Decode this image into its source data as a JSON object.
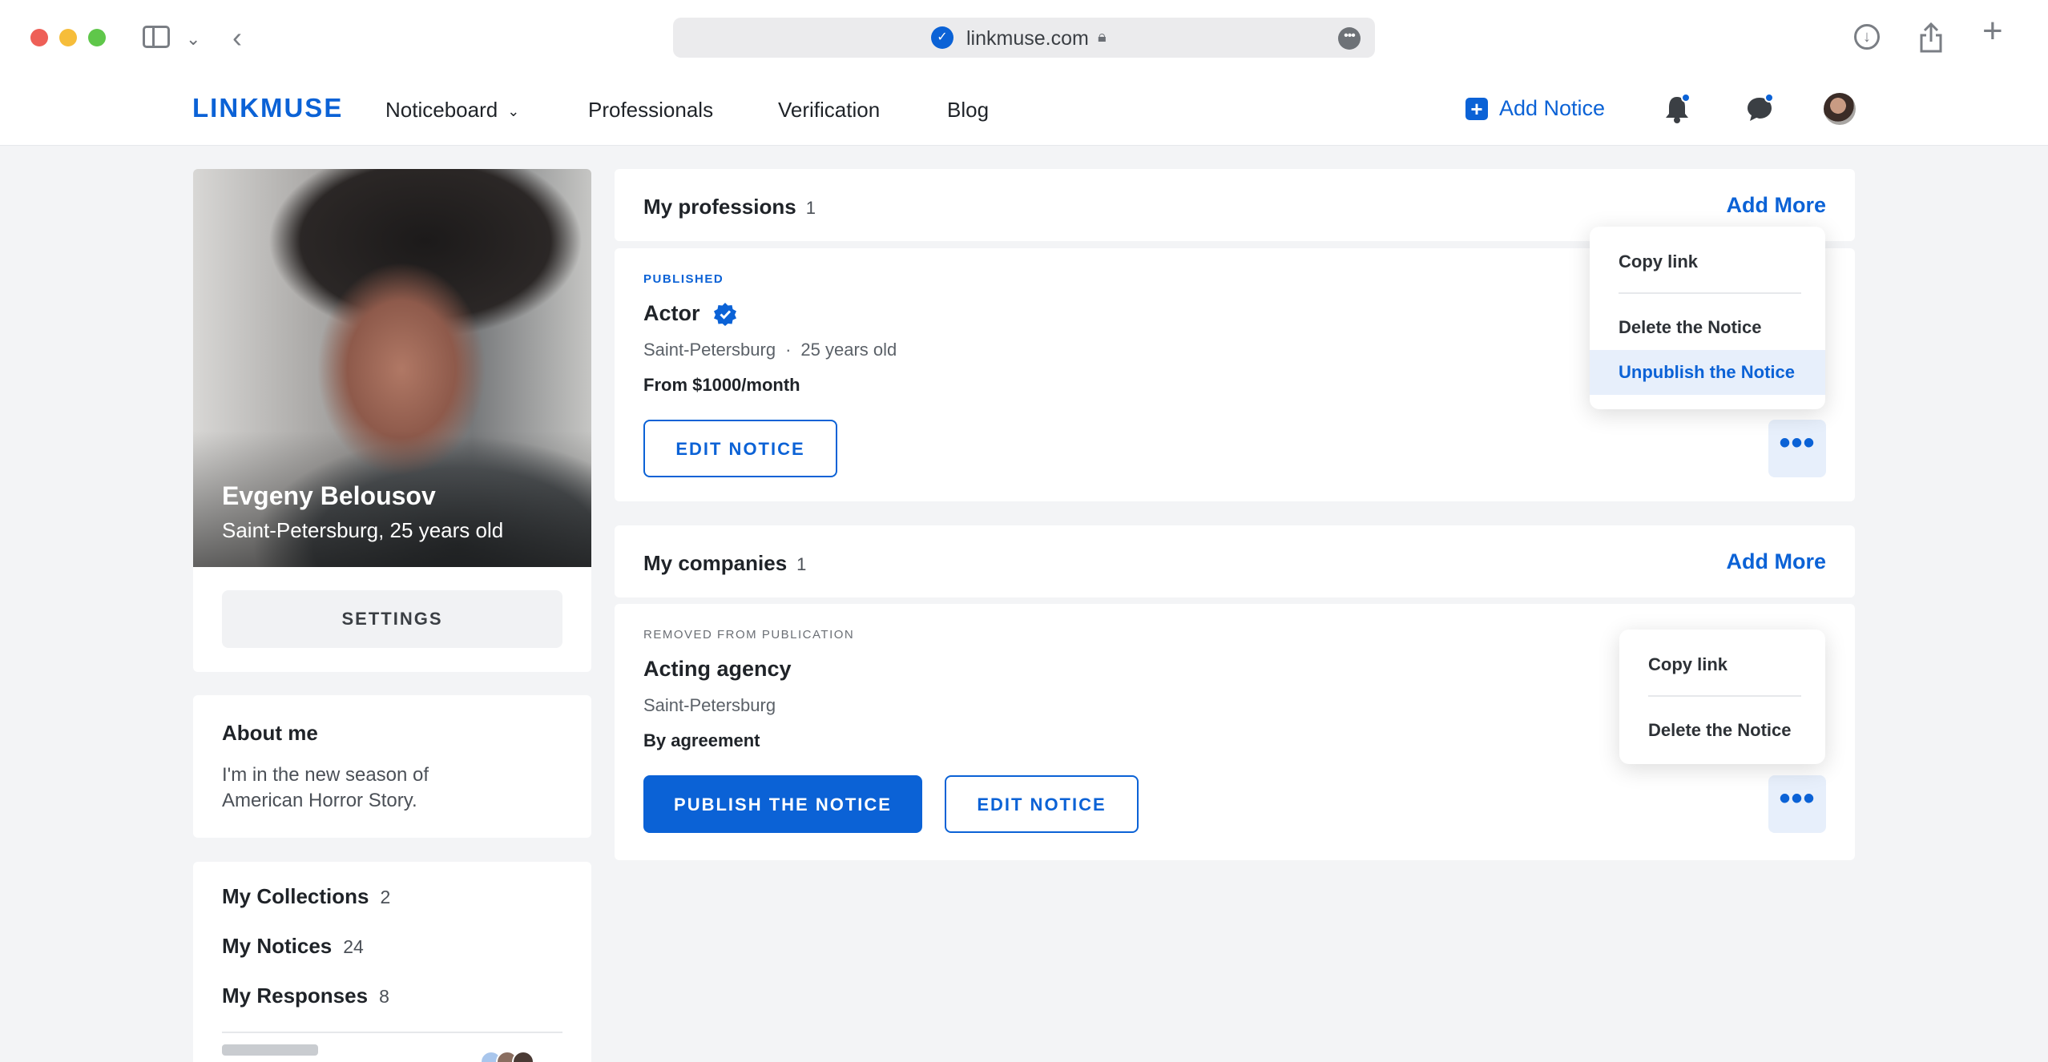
{
  "browser": {
    "url": "linkmuse.com"
  },
  "header": {
    "logo": "LINKMUSE",
    "nav": [
      "Noticeboard",
      "Professionals",
      "Verification",
      "Blog"
    ],
    "add_notice": "Add Notice"
  },
  "profile": {
    "name": "Evgeny Belousov",
    "subtitle": "Saint-Petersburg, 25 years old",
    "settings_label": "SETTINGS"
  },
  "about": {
    "title": "About me",
    "text": "I'm in the new season of American Horror Story."
  },
  "stats": [
    {
      "label": "My Collections",
      "count": "2"
    },
    {
      "label": "My Notices",
      "count": "24"
    },
    {
      "label": "My Responses",
      "count": "8"
    }
  ],
  "professions": {
    "title": "My professions",
    "count": "1",
    "add_more": "Add More",
    "item": {
      "status": "PUBLISHED",
      "title": "Actor",
      "city": "Saint-Petersburg",
      "age": "25 years old",
      "price": "From $1000/month",
      "edit_label": "EDIT NOTICE"
    },
    "menu": [
      "Copy link",
      "Delete the Notice",
      "Unpublish the Notice"
    ]
  },
  "companies": {
    "title": "My companies",
    "count": "1",
    "add_more": "Add More",
    "item": {
      "status": "REMOVED FROM PUBLICATION",
      "title": "Acting agency",
      "city": "Saint-Petersburg",
      "price": "By agreement",
      "publish_label": "PUBLISH THE NOTICE",
      "edit_label": "EDIT NOTICE"
    },
    "menu": [
      "Copy link",
      "Delete the Notice"
    ]
  },
  "colors": {
    "accent": "#0b62d6",
    "background": "#f3f4f6"
  }
}
